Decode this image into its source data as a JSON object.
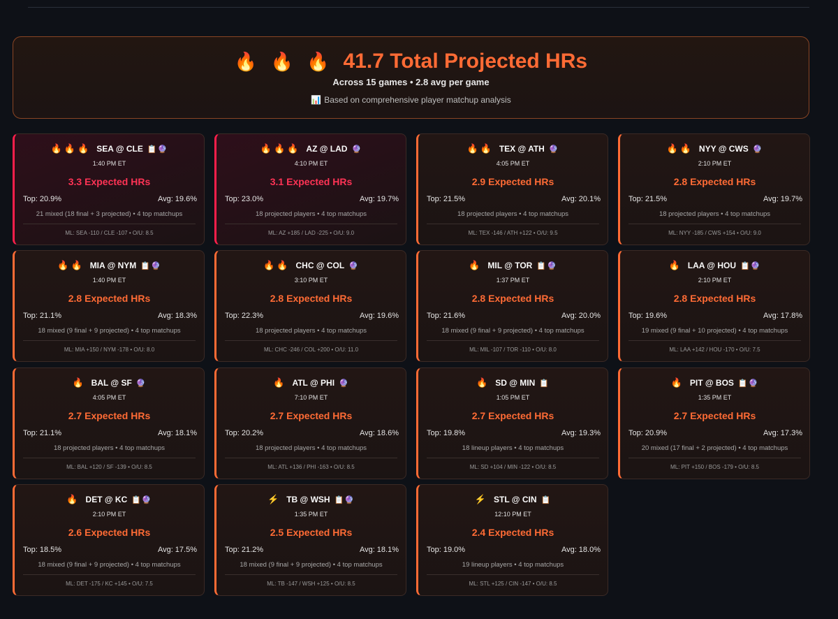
{
  "summary": {
    "flames": "🔥 🔥 🔥",
    "title": "41.7 Total Projected HRs",
    "subtitle": "Across 15 games • 2.8 avg per game",
    "note_icon": "📊",
    "note": "Based on comprehensive player matchup analysis"
  },
  "colors": {
    "accent": "#ff6b35",
    "hot": "#ff3355",
    "background": "#0e1117"
  },
  "games": [
    {
      "flames": "🔥🔥🔥",
      "matchup": "SEA @ CLE",
      "icons": "📋🔮",
      "time": "1:40 PM ET",
      "expected": "3.3 Expected HRs",
      "top": "Top: 20.9%",
      "avg": "Avg: 19.6%",
      "players": "21 mixed (18 final + 3 projected) • 4 top matchups",
      "ml": "ML: SEA -110 / CLE -107 • O/U: 8.5",
      "hot": true
    },
    {
      "flames": "🔥🔥🔥",
      "matchup": "AZ @ LAD",
      "icons": "🔮",
      "time": "4:10 PM ET",
      "expected": "3.1 Expected HRs",
      "top": "Top: 23.0%",
      "avg": "Avg: 19.7%",
      "players": "18 projected players • 4 top matchups",
      "ml": "ML: AZ +185 / LAD -225 • O/U: 9.0",
      "hot": true
    },
    {
      "flames": "🔥🔥",
      "matchup": "TEX @ ATH",
      "icons": "🔮",
      "time": "4:05 PM ET",
      "expected": "2.9 Expected HRs",
      "top": "Top: 21.5%",
      "avg": "Avg: 20.1%",
      "players": "18 projected players • 4 top matchups",
      "ml": "ML: TEX -146 / ATH +122 • O/U: 9.5",
      "hot": false
    },
    {
      "flames": "🔥🔥",
      "matchup": "NYY @ CWS",
      "icons": "🔮",
      "time": "2:10 PM ET",
      "expected": "2.8 Expected HRs",
      "top": "Top: 21.5%",
      "avg": "Avg: 19.7%",
      "players": "18 projected players • 4 top matchups",
      "ml": "ML: NYY -185 / CWS +154 • O/U: 9.0",
      "hot": false
    },
    {
      "flames": "🔥🔥",
      "matchup": "MIA @ NYM",
      "icons": "📋🔮",
      "time": "1:40 PM ET",
      "expected": "2.8 Expected HRs",
      "top": "Top: 21.1%",
      "avg": "Avg: 18.3%",
      "players": "18 mixed (9 final + 9 projected) • 4 top matchups",
      "ml": "ML: MIA +150 / NYM -178 • O/U: 8.0",
      "hot": false
    },
    {
      "flames": "🔥🔥",
      "matchup": "CHC @ COL",
      "icons": "🔮",
      "time": "3:10 PM ET",
      "expected": "2.8 Expected HRs",
      "top": "Top: 22.3%",
      "avg": "Avg: 19.6%",
      "players": "18 projected players • 4 top matchups",
      "ml": "ML: CHC -246 / COL +200 • O/U: 11.0",
      "hot": false
    },
    {
      "flames": "🔥",
      "matchup": "MIL @ TOR",
      "icons": "📋🔮",
      "time": "1:37 PM ET",
      "expected": "2.8 Expected HRs",
      "top": "Top: 21.6%",
      "avg": "Avg: 20.0%",
      "players": "18 mixed (9 final + 9 projected) • 4 top matchups",
      "ml": "ML: MIL -107 / TOR -110 • O/U: 8.0",
      "hot": false
    },
    {
      "flames": "🔥",
      "matchup": "LAA @ HOU",
      "icons": "📋🔮",
      "time": "2:10 PM ET",
      "expected": "2.8 Expected HRs",
      "top": "Top: 19.6%",
      "avg": "Avg: 17.8%",
      "players": "19 mixed (9 final + 10 projected) • 4 top matchups",
      "ml": "ML: LAA +142 / HOU -170 • O/U: 7.5",
      "hot": false
    },
    {
      "flames": "🔥",
      "matchup": "BAL @ SF",
      "icons": "🔮",
      "time": "4:05 PM ET",
      "expected": "2.7 Expected HRs",
      "top": "Top: 21.1%",
      "avg": "Avg: 18.1%",
      "players": "18 projected players • 4 top matchups",
      "ml": "ML: BAL +120 / SF -139 • O/U: 8.5",
      "hot": false
    },
    {
      "flames": "🔥",
      "matchup": "ATL @ PHI",
      "icons": "🔮",
      "time": "7:10 PM ET",
      "expected": "2.7 Expected HRs",
      "top": "Top: 20.2%",
      "avg": "Avg: 18.6%",
      "players": "18 projected players • 4 top matchups",
      "ml": "ML: ATL +136 / PHI -163 • O/U: 8.5",
      "hot": false
    },
    {
      "flames": "🔥",
      "matchup": "SD @ MIN",
      "icons": "📋",
      "time": "1:05 PM ET",
      "expected": "2.7 Expected HRs",
      "top": "Top: 19.8%",
      "avg": "Avg: 19.3%",
      "players": "18 lineup players • 4 top matchups",
      "ml": "ML: SD +104 / MIN -122 • O/U: 8.5",
      "hot": false
    },
    {
      "flames": "🔥",
      "matchup": "PIT @ BOS",
      "icons": "📋🔮",
      "time": "1:35 PM ET",
      "expected": "2.7 Expected HRs",
      "top": "Top: 20.9%",
      "avg": "Avg: 17.3%",
      "players": "20 mixed (17 final + 2 projected) • 4 top matchups",
      "ml": "ML: PIT +150 / BOS -179 • O/U: 8.5",
      "hot": false
    },
    {
      "flames": "🔥",
      "matchup": "DET @ KC",
      "icons": "📋🔮",
      "time": "2:10 PM ET",
      "expected": "2.6 Expected HRs",
      "top": "Top: 18.5%",
      "avg": "Avg: 17.5%",
      "players": "18 mixed (9 final + 9 projected) • 4 top matchups",
      "ml": "ML: DET -175 / KC +145 • O/U: 7.5",
      "hot": false
    },
    {
      "flames": "⚡",
      "matchup": "TB @ WSH",
      "icons": "📋🔮",
      "time": "1:35 PM ET",
      "expected": "2.5 Expected HRs",
      "top": "Top: 21.2%",
      "avg": "Avg: 18.1%",
      "players": "18 mixed (9 final + 9 projected) • 4 top matchups",
      "ml": "ML: TB -147 / WSH +125 • O/U: 8.5",
      "hot": false
    },
    {
      "flames": "⚡",
      "matchup": "STL @ CIN",
      "icons": "📋",
      "time": "12:10 PM ET",
      "expected": "2.4 Expected HRs",
      "top": "Top: 19.0%",
      "avg": "Avg: 18.0%",
      "players": "19 lineup players • 4 top matchups",
      "ml": "ML: STL +125 / CIN -147 • O/U: 8.5",
      "hot": false
    }
  ]
}
